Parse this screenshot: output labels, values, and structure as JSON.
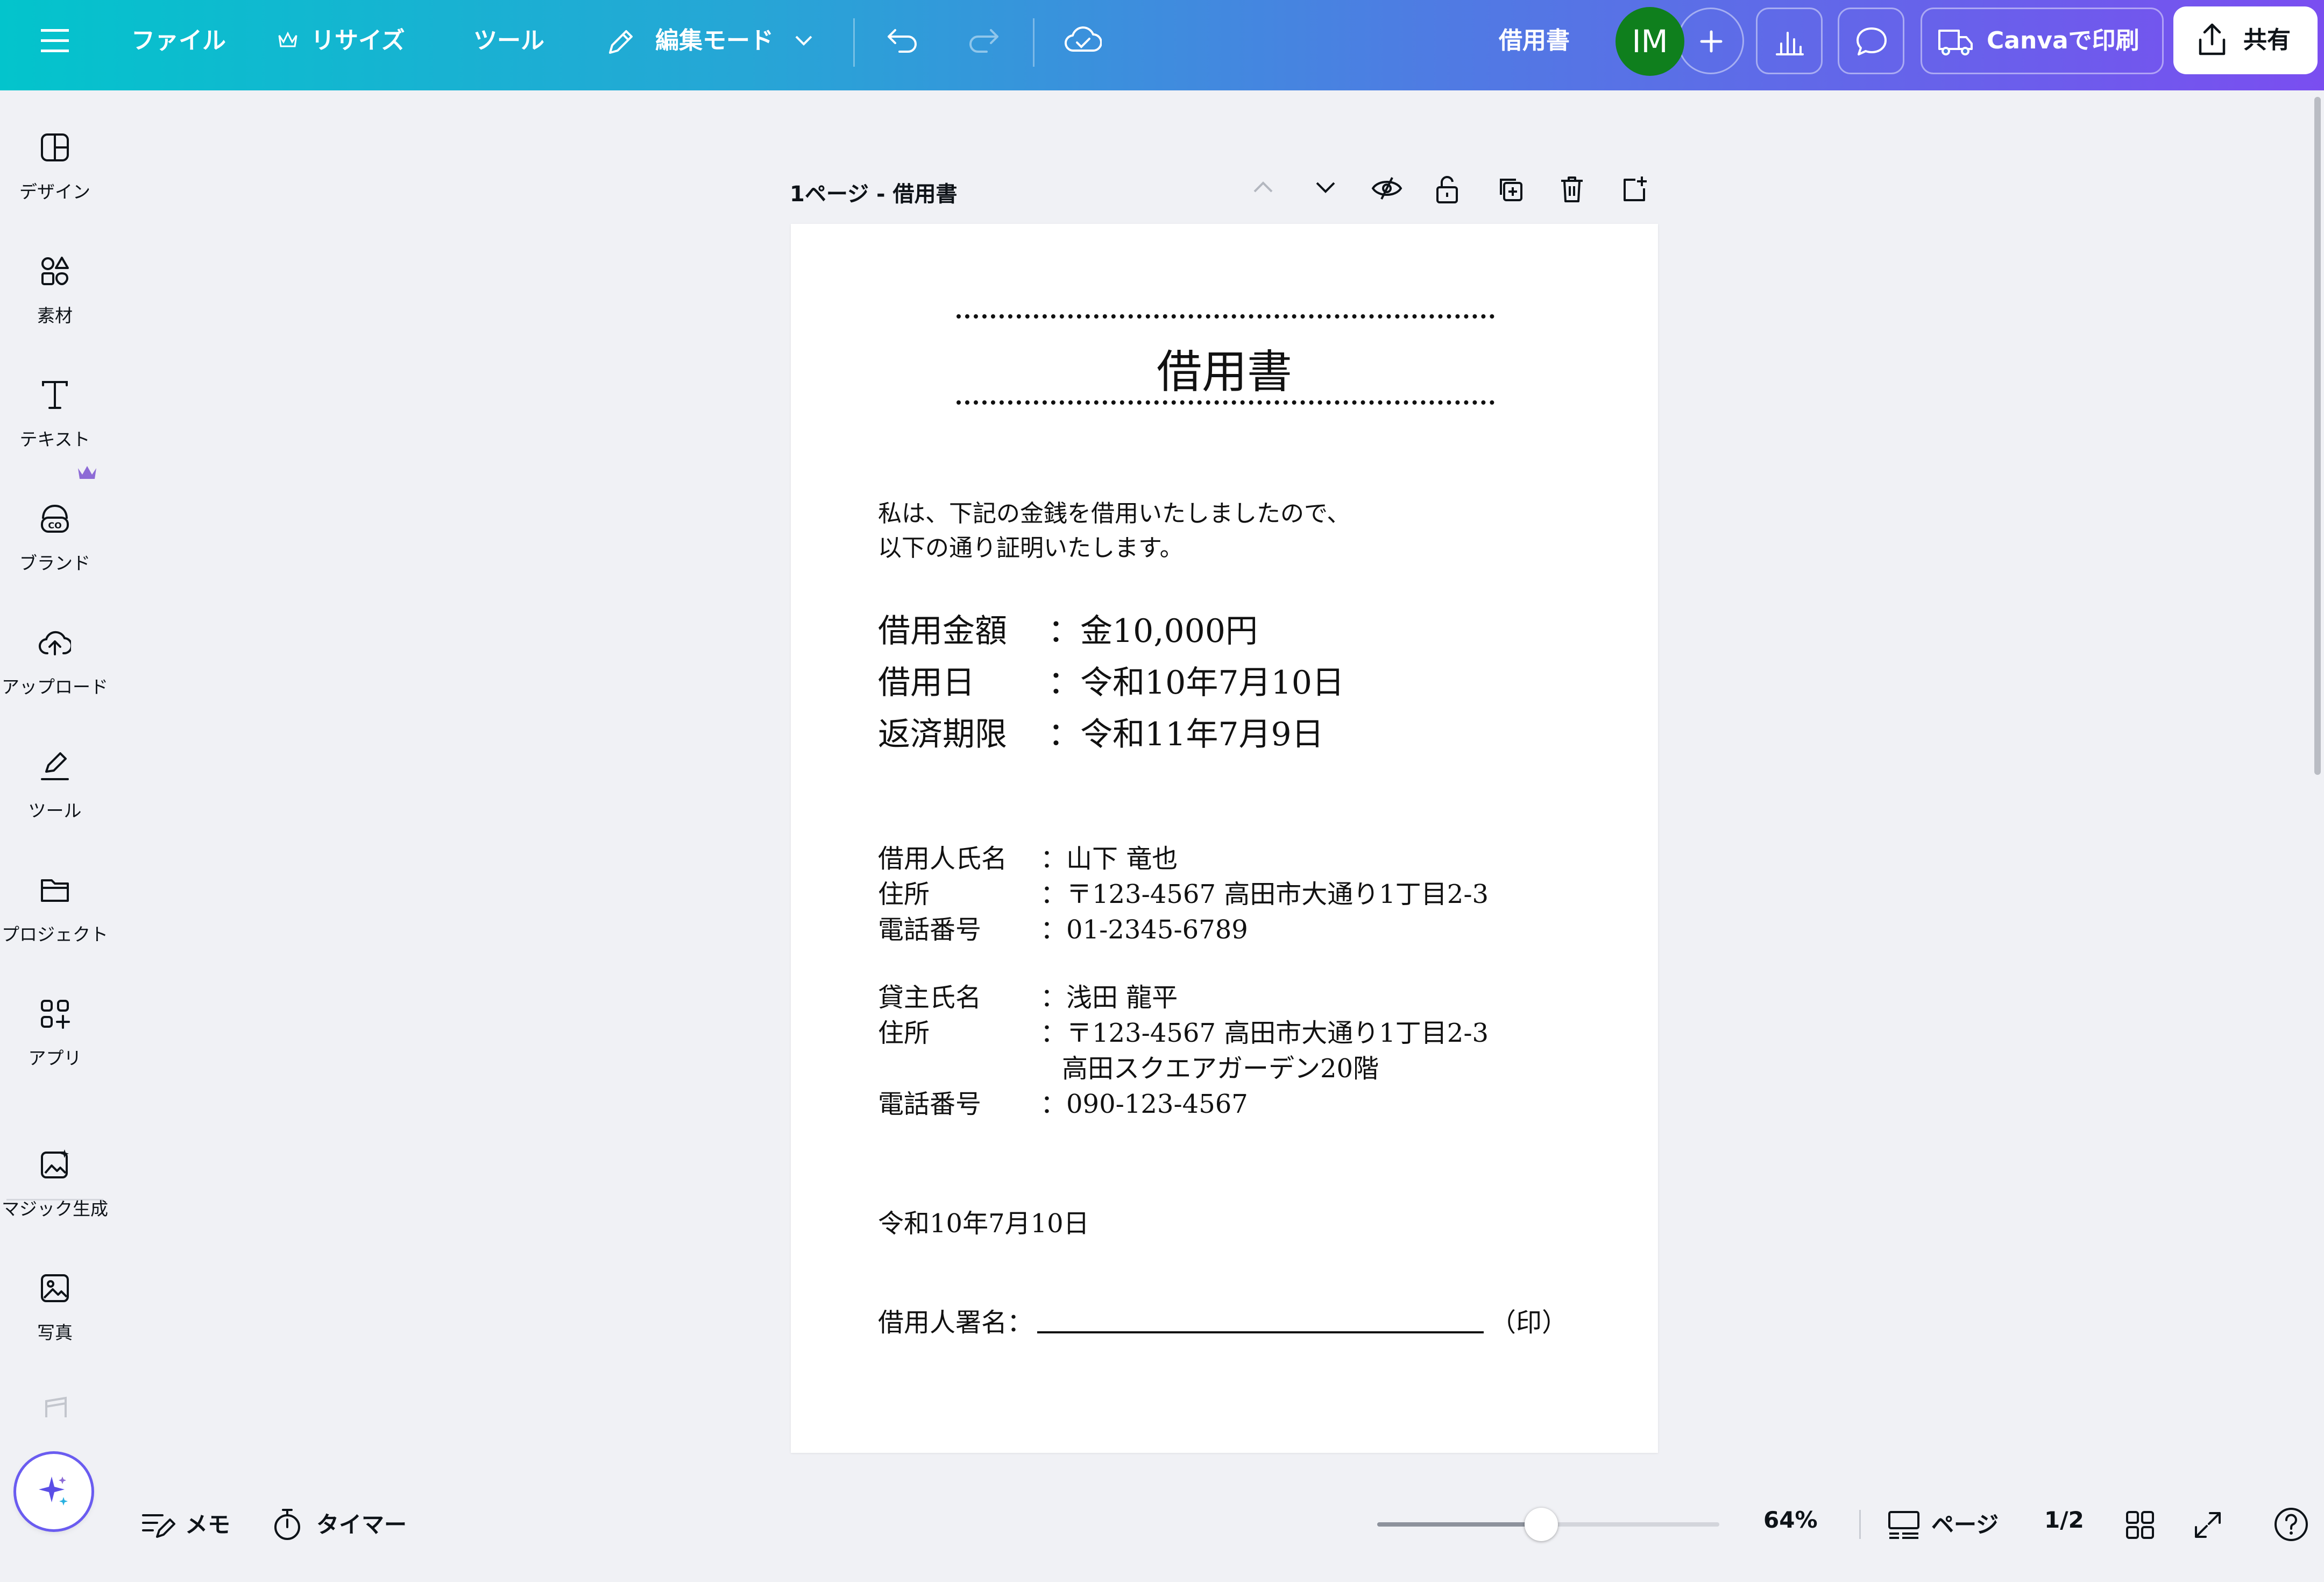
{
  "topbar": {
    "menu_icon": "hamburger-icon",
    "file": "ファイル",
    "resize": "リサイズ",
    "tools": "ツール",
    "edit_mode": "編集モード",
    "doc_title": "借用書",
    "avatar_initials": "IM",
    "print": "Canvaで印刷",
    "share": "共有"
  },
  "sidebar": {
    "items": [
      {
        "label": "デザイン",
        "icon": "design-icon"
      },
      {
        "label": "素材",
        "icon": "elements-icon"
      },
      {
        "label": "テキスト",
        "icon": "text-icon"
      },
      {
        "label": "ブランド",
        "icon": "brand-icon"
      },
      {
        "label": "アップロード",
        "icon": "upload-icon"
      },
      {
        "label": "ツール",
        "icon": "draw-icon"
      },
      {
        "label": "プロジェクト",
        "icon": "folder-icon"
      },
      {
        "label": "アプリ",
        "icon": "apps-icon"
      },
      {
        "label": "マジック生成",
        "icon": "magic-media-icon"
      },
      {
        "label": "写真",
        "icon": "photo-icon"
      }
    ]
  },
  "page_header": {
    "label": "1ページ - 借用書"
  },
  "document": {
    "title": "借用書",
    "intro_line1": "私は、下記の金銭を借用いたしましたので、",
    "intro_line2": "以下の通り証明いたします。",
    "loan_rows": [
      {
        "label": "借用金額",
        "value": "：金10,000円"
      },
      {
        "label": "借用日",
        "value": "：令和10年7月10日"
      },
      {
        "label": "返済期限",
        "value": "：令和11年7月9日"
      }
    ],
    "borrower": [
      {
        "label": "借用人氏名",
        "value": "：山下 竜也"
      },
      {
        "label": "住所",
        "value": "：〒123-4567 高田市大通り1丁目2-3"
      },
      {
        "label": "電話番号",
        "value": "：01-2345-6789"
      }
    ],
    "lender": [
      {
        "label": "貸主氏名",
        "value": "：浅田 龍平"
      },
      {
        "label": "住所",
        "value": "：〒123-4567 高田市大通り1丁目2-3"
      },
      {
        "label": "",
        "value": "高田スクエアガーデン20階"
      },
      {
        "label": "電話番号",
        "value": "：090-123-4567"
      }
    ],
    "date": "令和10年7月10日",
    "signature_label": "借用人署名：",
    "seal_label": "（印）"
  },
  "bottombar": {
    "memo": "メモ",
    "timer": "タイマー",
    "zoom": "64%",
    "zoom_level": 0.48,
    "pages": "ページ",
    "page_count": "1/2"
  }
}
